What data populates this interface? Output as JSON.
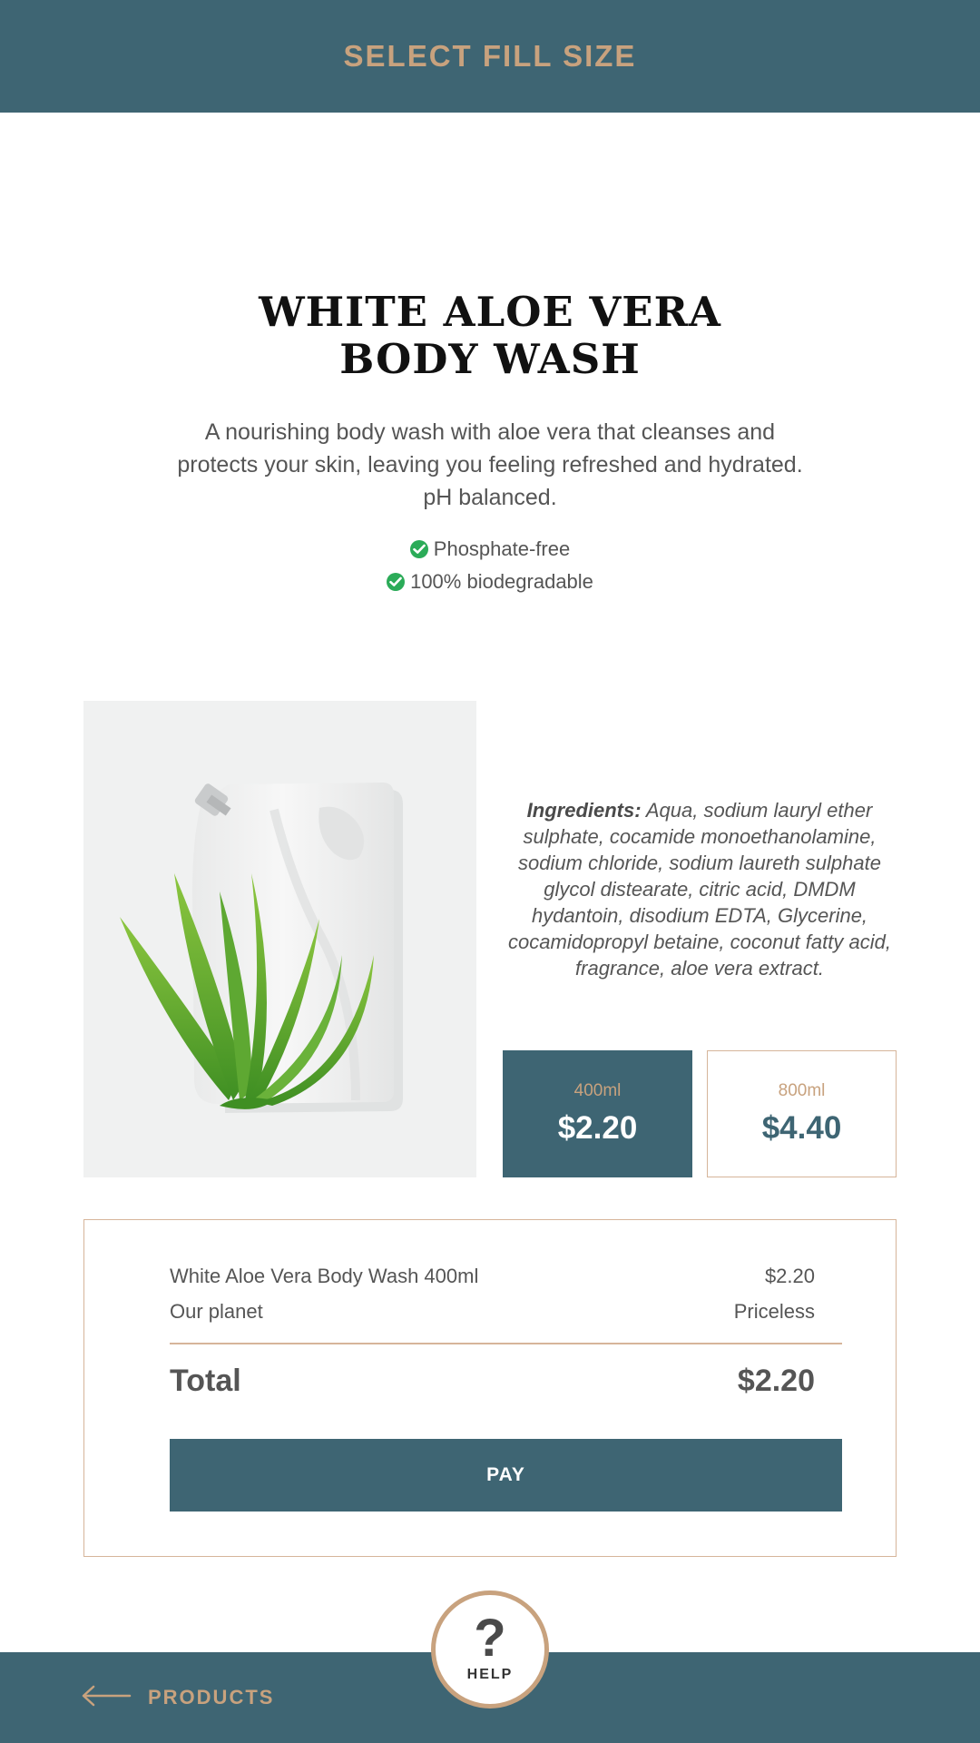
{
  "header": {
    "title": "SELECT FILL SIZE"
  },
  "product": {
    "title_line1": "WHITE ALOE VERA",
    "title_line2": "BODY WASH",
    "description": "A nourishing body wash with aloe vera that cleanses and protects your skin, leaving you feeling refreshed and hydrated. pH balanced.",
    "features": [
      "Phosphate-free",
      "100% biodegradable"
    ],
    "ingredients_label": "Ingredients:",
    "ingredients_text": "Aqua, sodium lauryl ether sulphate, cocamide monoethanolamine, sodium chloride, sodium laureth sulphate glycol distearate, citric acid, DMDM hydantoin, disodium EDTA, Glycerine, cocamidopropyl betaine, coconut fatty acid, fragrance, aloe vera extract."
  },
  "sizes": [
    {
      "volume": "400ml",
      "price": "$2.20",
      "selected": true
    },
    {
      "volume": "800ml",
      "price": "$4.40",
      "selected": false
    }
  ],
  "summary": {
    "lines": [
      {
        "label": "White Aloe Vera Body Wash 400ml",
        "value": "$2.20"
      },
      {
        "label": "Our planet",
        "value": "Priceless"
      }
    ],
    "total_label": "Total",
    "total_value": "$2.20",
    "pay_label": "PAY"
  },
  "footer": {
    "back_label": "PRODUCTS",
    "help_symbol": "?",
    "help_label": "HELP"
  },
  "colors": {
    "brand_teal": "#3e6573",
    "accent_tan": "#c8a27e",
    "check_green": "#2bab58"
  },
  "icons": {
    "feature": "check-circle-icon",
    "back": "arrow-left-icon",
    "help": "question-mark-icon"
  }
}
